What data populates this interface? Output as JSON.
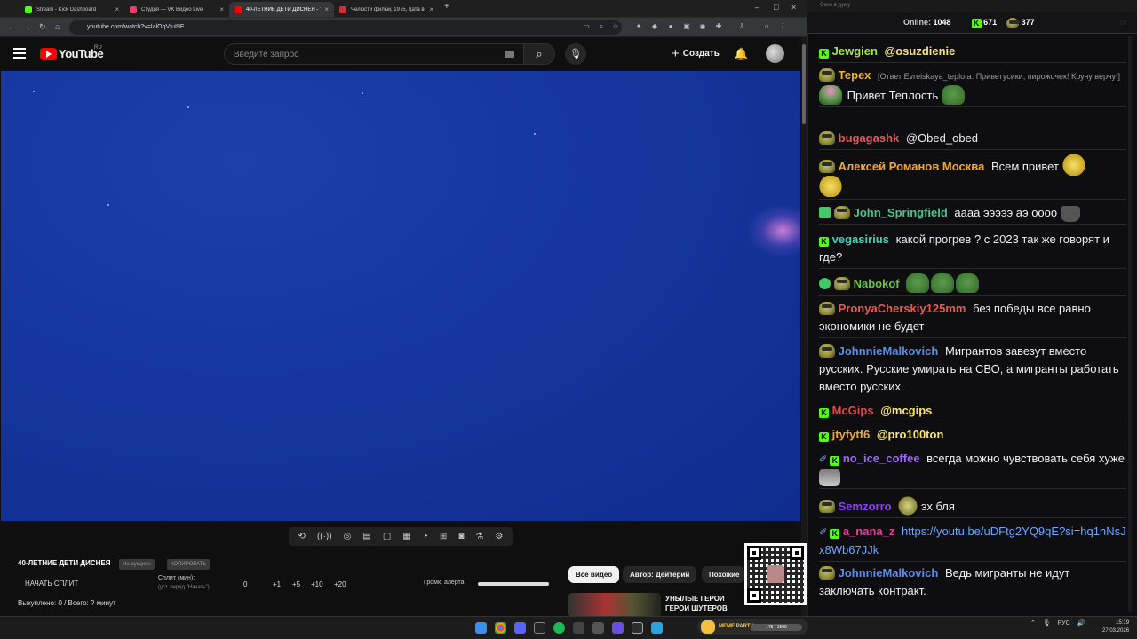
{
  "browser": {
    "tabs": [
      {
        "title": "Stream - Kick Dashboard",
        "color": "#53fc18"
      },
      {
        "title": "Студия — VK Видео Live",
        "color": "#e83f6b"
      },
      {
        "title": "40-ЛЕТНИЕ ДЕТИ ДИСНЕЯ - YouTube",
        "color": "#ff0000"
      },
      {
        "title": "Челюсти фильм, 1975, дата вы...",
        "color": "#c33"
      }
    ],
    "new_tab": "+",
    "url": "youtube.com/watch?v=IalOqVfuI9E"
  },
  "youtube": {
    "logo_text": "YouTube",
    "region": "RU",
    "search_placeholder": "Введите запрос",
    "create_label": "Создать"
  },
  "video_panel": {
    "title": "40-ЛЕТНИЕ ДЕТИ ДИСНЕЯ",
    "pill_auction": "На аукцион",
    "pill_copy": "КОПИРОВАТЬ",
    "split_button": "НАЧАТЬ СПЛИТ",
    "split_label": "Сплит (мин):",
    "split_sub": "(уст. перед \"Начать\")",
    "split_values": [
      "0",
      "+1",
      "+5",
      "+10",
      "+20"
    ],
    "bought": "Выкуплено: 0 / Всего: ? минут",
    "alert_volume": "Громк. алерта:"
  },
  "chips": [
    "Все видео",
    "Автор: Дейтерий",
    "Похожие"
  ],
  "recommended": {
    "title": "УНЫЛЫЕ ГЕРОИ ГЕРОИ ШУТЕРОВ"
  },
  "chat": {
    "window_title": "Окно в думу",
    "online_label": "Online:",
    "online_count": "1048",
    "kick_count": "671",
    "other_count": "377",
    "messages": [
      {
        "user": "Jewgien",
        "color": "#a3e635",
        "text": "@osuzdienie",
        "text_color": "#f8e36b"
      },
      {
        "user": "Терех",
        "color": "#f0b429",
        "reply": "[Ответ Evreiskaya_teplota: Приветусики, пирожочек! Кручу верчу!]",
        "text": "Привет Теплость"
      },
      {
        "user": "bugagashk",
        "color": "#e05a5a",
        "text": "@Obed_obed"
      },
      {
        "user": "Алексей Романов Москва",
        "color": "#f0a830",
        "text": "Всем привет"
      },
      {
        "user": "John_Springfield",
        "color": "#4cc48a",
        "text": "аааа эээээ аэ оооо"
      },
      {
        "user": "vegasirius",
        "color": "#3fd4b4",
        "text": "какой прогрев ? с 2023 так же говорят и где?"
      },
      {
        "user": "Nabokof",
        "color": "#6cc04a",
        "text": ""
      },
      {
        "user": "PronyaCherskiy125mm",
        "color": "#e85a4f",
        "text": "без победы все равно экономики не будет"
      },
      {
        "user": "JohnnieMalkovich",
        "color": "#5b8df0",
        "text": "Мигрантов завезут вместо русских. Русские умирать на СВО, а мигранты работать вместо русских."
      },
      {
        "user": "McGips",
        "color": "#e04848",
        "text": "@mcgips",
        "text_color": "#f8e36b"
      },
      {
        "user": "jtyfytf6",
        "color": "#f0a830",
        "text": "@pro100ton",
        "text_color": "#f8e36b"
      },
      {
        "user": "no_ice_coffee",
        "color": "#9b6cf0",
        "text": "всегда можно чувствовать себя хуже"
      },
      {
        "user": "Semzorro",
        "color": "#8b3ff0",
        "text": "эх бля"
      },
      {
        "user": "a_nana_z",
        "color": "#e0409a",
        "text": "https://youtu.be/uDFtg2YQ9qE?si=hq1nNsJx8Wb67JJk"
      },
      {
        "user": "JohnnieMalkovich",
        "color": "#5b8df0",
        "text": "Ведь мигранты не идут заключать контракт."
      }
    ]
  },
  "taskbar": {
    "meme_party": "MEME PARTY",
    "meme_progress": "175 / 1500",
    "lang": "РУС",
    "time": "15:19",
    "date": "27.03.2026"
  }
}
